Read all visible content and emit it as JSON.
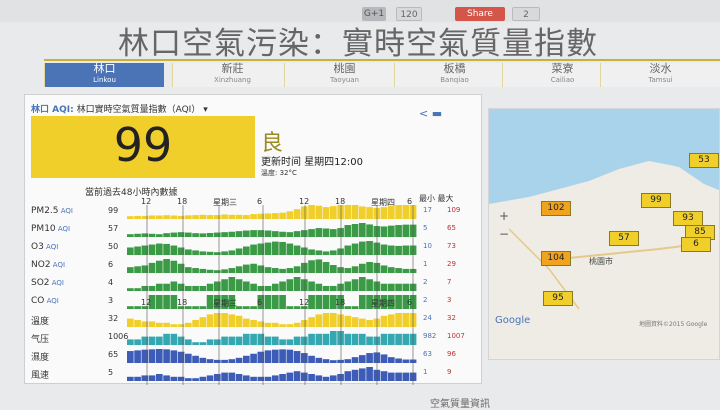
{
  "topbar": {
    "gplus_label": "G+1",
    "gplus_count": "120",
    "share_label": "Share",
    "share_count": "2"
  },
  "page_title": "林口空氣污染：實時空氣質量指數",
  "tabs": [
    {
      "zh": "林口",
      "en": "Linkou",
      "active": true
    },
    {
      "zh": "新莊",
      "en": "Xinzhuang"
    },
    {
      "zh": "桃園",
      "en": "Taoyuan"
    },
    {
      "zh": "板橋",
      "en": "Banqiao"
    },
    {
      "zh": "菜寮",
      "en": "Cailiao"
    },
    {
      "zh": "淡水",
      "en": "Tamsui"
    }
  ],
  "panel": {
    "title_prefix": "林口 AQI:",
    "title_text": "林口實時空氣質量指數（AQI）",
    "aqi": "99",
    "grade": "良",
    "updated": "更新时间 星期四12:00",
    "temperature": "溫度: 32°C",
    "chart_title": "當前過去48小時內數據",
    "minmax_header": "最小 最大"
  },
  "chart_data": {
    "type": "bar",
    "title": "當前過去48小時內數據",
    "x_ticks": [
      "12",
      "18",
      "星期三",
      "6",
      "12",
      "18",
      "星期四",
      "6",
      "12"
    ],
    "rows": [
      {
        "name": "PM2.5",
        "unit": "AQI",
        "current": "99",
        "min": "17",
        "max": "109",
        "color": "#f1cf2a",
        "values": [
          20,
          22,
          22,
          25,
          25,
          27,
          25,
          22,
          26,
          28,
          30,
          28,
          28,
          32,
          30,
          30,
          28,
          35,
          38,
          40,
          42,
          45,
          55,
          70,
          90,
          100,
          95,
          85,
          92,
          100,
          100,
          100,
          90,
          85,
          80,
          85,
          95,
          100,
          100,
          100
        ]
      },
      {
        "name": "PM10",
        "unit": "AQI",
        "current": "57",
        "min": "5",
        "max": "65",
        "color": "#3a9a45",
        "values": [
          10,
          12,
          14,
          12,
          10,
          15,
          18,
          20,
          18,
          15,
          14,
          16,
          18,
          20,
          22,
          25,
          28,
          30,
          30,
          28,
          25,
          22,
          20,
          25,
          30,
          35,
          40,
          38,
          35,
          40,
          55,
          60,
          65,
          58,
          50,
          48,
          52,
          55,
          57,
          57
        ]
      },
      {
        "name": "O3",
        "unit": "AQI",
        "current": "50",
        "min": "10",
        "max": "73",
        "color": "#3a9a45",
        "values": [
          40,
          45,
          50,
          55,
          60,
          58,
          50,
          40,
          30,
          25,
          20,
          18,
          16,
          20,
          25,
          35,
          45,
          55,
          60,
          65,
          70,
          68,
          60,
          50,
          40,
          30,
          25,
          20,
          25,
          35,
          50,
          60,
          70,
          73,
          65,
          55,
          50,
          48,
          50,
          50
        ]
      },
      {
        "name": "NO2",
        "unit": "AQI",
        "current": "6",
        "min": "1",
        "max": "29",
        "color": "#3a9a45",
        "values": [
          10,
          12,
          14,
          20,
          25,
          29,
          25,
          18,
          10,
          8,
          6,
          4,
          3,
          5,
          8,
          12,
          16,
          18,
          14,
          10,
          8,
          6,
          8,
          12,
          20,
          26,
          28,
          22,
          15,
          10,
          8,
          12,
          18,
          22,
          20,
          14,
          10,
          8,
          6,
          6
        ]
      },
      {
        "name": "SO2",
        "unit": "AQI",
        "current": "4",
        "min": "2",
        "max": "7",
        "color": "#3a9a45",
        "values": [
          2,
          2,
          3,
          3,
          4,
          4,
          5,
          4,
          3,
          3,
          3,
          4,
          5,
          6,
          7,
          6,
          5,
          4,
          3,
          3,
          4,
          5,
          6,
          7,
          6,
          5,
          4,
          3,
          3,
          4,
          5,
          6,
          7,
          6,
          5,
          4,
          4,
          4,
          4,
          4
        ]
      },
      {
        "name": "CO",
        "unit": "AQI",
        "current": "3",
        "min": "2",
        "max": "3",
        "color": "#3a9a45",
        "values": [
          2,
          2,
          2,
          3,
          3,
          3,
          3,
          2,
          2,
          2,
          2,
          3,
          3,
          3,
          3,
          2,
          2,
          2,
          3,
          3,
          3,
          3,
          2,
          2,
          2,
          3,
          3,
          3,
          3,
          3,
          2,
          2,
          3,
          3,
          3,
          3,
          3,
          3,
          3,
          3
        ]
      },
      {
        "name": "溫度",
        "unit": "",
        "current": "32",
        "min": "24",
        "max": "32",
        "color": "#f1cf2a",
        "values": [
          28,
          27,
          26,
          26,
          25,
          25,
          24,
          24,
          25,
          27,
          29,
          31,
          32,
          32,
          31,
          30,
          28,
          27,
          26,
          25,
          25,
          24,
          24,
          25,
          27,
          29,
          31,
          32,
          32,
          31,
          30,
          29,
          28,
          27,
          28,
          30,
          31,
          32,
          32,
          32
        ]
      },
      {
        "name": "气压",
        "unit": "",
        "current": "1006",
        "min": "982",
        "max": "1007",
        "color": "#34a8b0",
        "values": [
          1004,
          1004,
          1005,
          1005,
          1005,
          1006,
          1006,
          1005,
          1004,
          1003,
          1003,
          1004,
          1004,
          1005,
          1005,
          1005,
          1006,
          1006,
          1006,
          1005,
          1005,
          1004,
          1004,
          1005,
          1005,
          1006,
          1006,
          1006,
          1007,
          1007,
          1006,
          1006,
          1006,
          1005,
          1005,
          1006,
          1006,
          1006,
          1006,
          1006
        ]
      },
      {
        "name": "濕度",
        "unit": "",
        "current": "65",
        "min": "63",
        "max": "96",
        "color": "#3c5cb8",
        "values": [
          90,
          92,
          94,
          95,
          96,
          95,
          92,
          88,
          82,
          76,
          70,
          66,
          64,
          64,
          66,
          70,
          76,
          82,
          88,
          92,
          94,
          95,
          94,
          90,
          84,
          76,
          70,
          66,
          63,
          64,
          66,
          72,
          78,
          84,
          86,
          80,
          72,
          68,
          65,
          65
        ]
      },
      {
        "name": "風速",
        "unit": "",
        "current": "5",
        "min": "1",
        "max": "9",
        "color": "#3c5cb8",
        "values": [
          2,
          2,
          3,
          3,
          4,
          3,
          2,
          2,
          1,
          1,
          2,
          3,
          4,
          5,
          5,
          4,
          3,
          2,
          2,
          2,
          3,
          4,
          5,
          6,
          5,
          4,
          3,
          2,
          3,
          4,
          6,
          7,
          8,
          9,
          7,
          6,
          5,
          5,
          5,
          5
        ]
      }
    ]
  },
  "map": {
    "zoom_in": "+",
    "zoom_out": "−",
    "google": "Google",
    "copyright": "地圖資料©2015 Google",
    "place": "桃園市",
    "markers": [
      {
        "value": "53",
        "color": "#f1cf2a"
      },
      {
        "value": "99",
        "color": "#f1cf2a"
      },
      {
        "value": "102",
        "color": "#f0a31f"
      },
      {
        "value": "93",
        "color": "#f1cf2a"
      },
      {
        "value": "85",
        "color": "#f1cf2a"
      },
      {
        "value": "57",
        "color": "#f1cf2a"
      },
      {
        "value": "104",
        "color": "#f0a31f"
      },
      {
        "value": "6",
        "color": "#f1cf2a"
      },
      {
        "value": "95",
        "color": "#f1cf2a"
      }
    ]
  },
  "footer": {
    "text": "空氣質量資訊"
  }
}
